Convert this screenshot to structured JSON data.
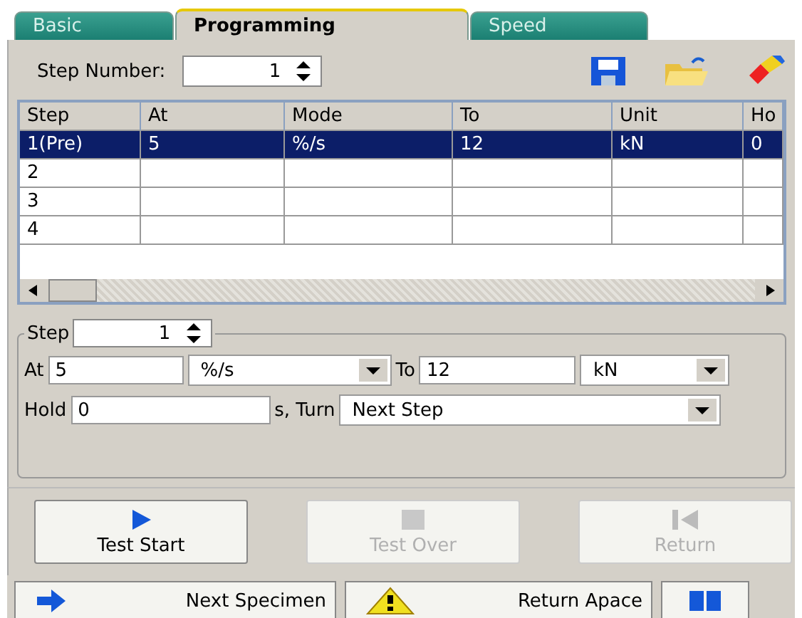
{
  "tabs": [
    {
      "label": "Basic",
      "selected": false
    },
    {
      "label": "Programming",
      "selected": true
    },
    {
      "label": "Speed",
      "selected": false
    }
  ],
  "step_number": {
    "label": "Step Number:",
    "value": "1"
  },
  "table": {
    "columns": [
      "Step",
      "At",
      "Mode",
      "To",
      "Unit",
      "Ho"
    ],
    "rows": [
      {
        "cells": [
          "1(Pre)",
          "5",
          "%/s",
          "12",
          "kN",
          "0"
        ],
        "selected": true
      },
      {
        "cells": [
          "2",
          "",
          "",
          "",
          "",
          ""
        ],
        "selected": false
      },
      {
        "cells": [
          "3",
          "",
          "",
          "",
          "",
          ""
        ],
        "selected": false
      },
      {
        "cells": [
          "4",
          "",
          "",
          "",
          "",
          ""
        ],
        "selected": false
      }
    ]
  },
  "step_group": {
    "label": "Step",
    "value": "1",
    "at_label": "At",
    "at_value": "5",
    "mode_value": "%/s",
    "to_label": "To",
    "to_value": "12",
    "unit_value": "kN",
    "hold_label": "Hold",
    "hold_value": "0",
    "turn_label": "s, Turn",
    "turn_value": "Next Step"
  },
  "actions": [
    {
      "label": "Test Start",
      "kind": "start",
      "disabled": false
    },
    {
      "label": "Test Over",
      "kind": "stop",
      "disabled": true
    },
    {
      "label": "Return",
      "kind": "return",
      "disabled": true
    }
  ],
  "bottom": [
    {
      "label": "Next Specimen",
      "kind": "next"
    },
    {
      "label": "Return Apace",
      "kind": "warn"
    },
    {
      "kind": "pause"
    }
  ]
}
